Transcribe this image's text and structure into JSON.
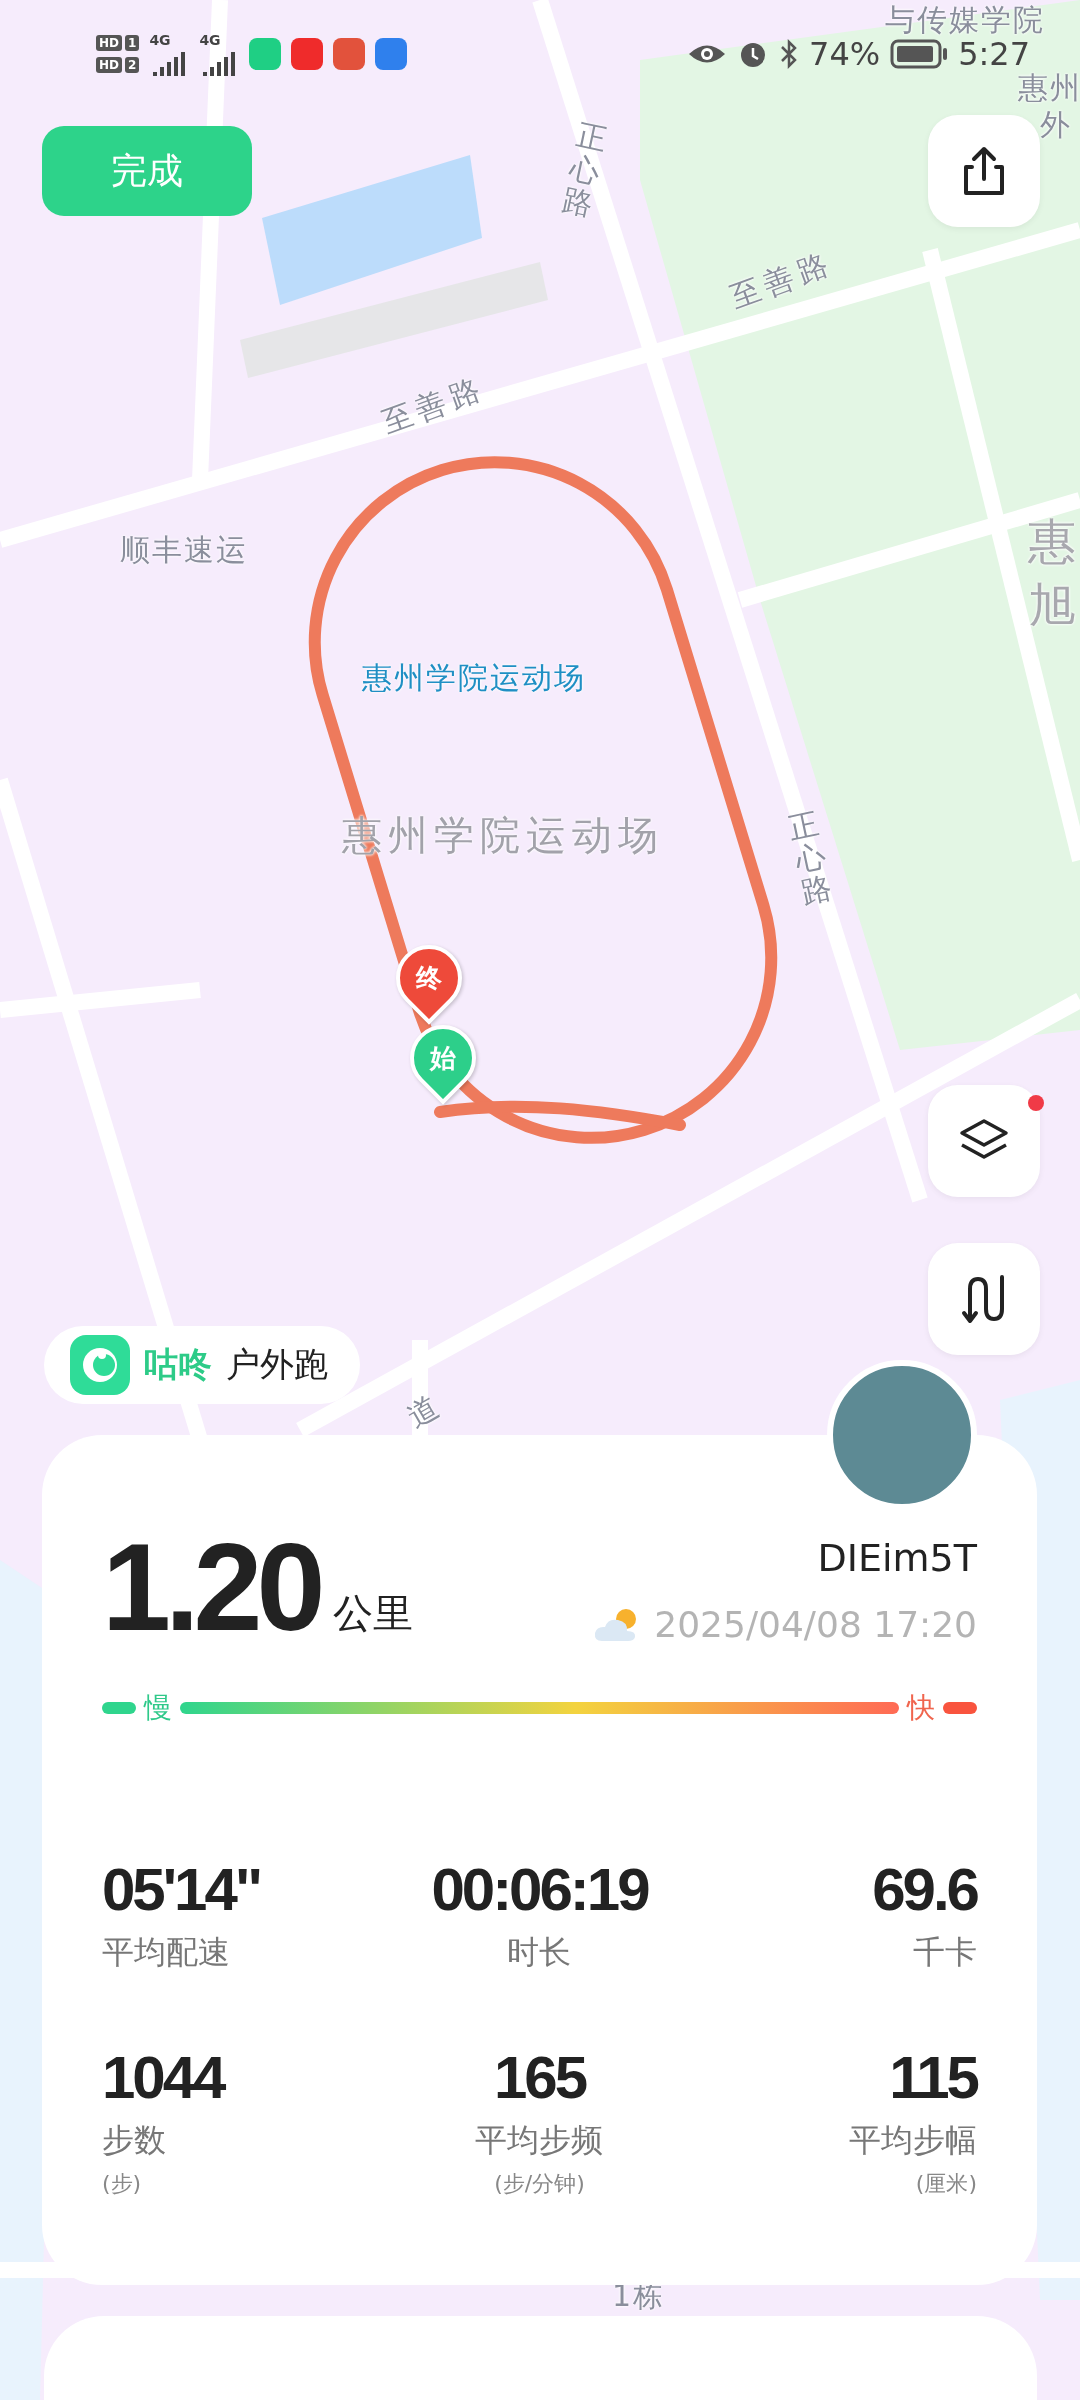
{
  "status_bar": {
    "sims": [
      {
        "badge": "HD",
        "slot": "1",
        "network": "4G"
      },
      {
        "badge": "HD",
        "slot": "2",
        "network": "4G"
      }
    ],
    "battery": "74%",
    "time": "5:27"
  },
  "done_button": "完成",
  "map": {
    "labels": [
      {
        "text": "与传媒学院",
        "kind": "place"
      },
      {
        "text": "惠州",
        "kind": "place"
      },
      {
        "text": "外",
        "kind": "place"
      },
      {
        "text": "正心路",
        "kind": "road_vertical"
      },
      {
        "text": "至善路",
        "kind": "road"
      },
      {
        "text": "至善路",
        "kind": "road"
      },
      {
        "text": "顺丰速运",
        "kind": "place"
      },
      {
        "text": "惠",
        "kind": "big"
      },
      {
        "text": "旭",
        "kind": "big"
      },
      {
        "text": "惠州学院运动场",
        "kind": "poi"
      },
      {
        "text": "惠州学院运动场",
        "kind": "venue"
      },
      {
        "text": "正心路",
        "kind": "road_vertical"
      },
      {
        "text": "道",
        "kind": "road"
      },
      {
        "text": "1栋",
        "kind": "place"
      }
    ],
    "markers": [
      {
        "label": "终",
        "kind": "end"
      },
      {
        "label": "始",
        "kind": "start"
      }
    ]
  },
  "layers_button": {
    "notification": true
  },
  "app_badge": {
    "brand": "咕咚",
    "activity": "户外跑"
  },
  "summary": {
    "distance": "1.20",
    "unit": "公里",
    "user": "DIEim5T",
    "datetime": "2025/04/08 17:20",
    "slow": "慢",
    "fast": "快"
  },
  "stats": [
    {
      "value": "05'14\"",
      "label": "平均配速"
    },
    {
      "value": "00:06:19",
      "label": "时长"
    },
    {
      "value": "69.6",
      "label": "千卡"
    },
    {
      "value": "1044",
      "label": "步数",
      "unit": "(步)"
    },
    {
      "value": "165",
      "label": "平均步频",
      "unit": "(步/分钟)"
    },
    {
      "value": "115",
      "label": "平均步幅",
      "unit": "(厘米)"
    }
  ]
}
